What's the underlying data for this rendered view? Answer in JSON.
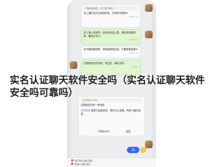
{
  "headline": {
    "line1": "实名认证聊天软件安全吗（实名认证聊天软件",
    "line2": "安全吗可靠吗）"
  },
  "chat": {
    "top_bubble": {
      "quote": "不要用微信群… 这个群不能再…",
      "text": "说上课在没办法发现的事，才那样不那样么",
      "time": "09:52 11"
    },
    "green_bubble_1": {
      "text": "说上课公司说的，目前没有进入群，等在按说明的事，最终红字已…",
      "time": "09:52 11"
    },
    "bubble_2": {
      "text": "也不要用微信群，说明该群的信息，不要用微信群么",
      "time": "09:52 11"
    },
    "green_bubble_2": {
      "quote": "@Albert Flores 没有发布的消息",
      "mention": "@Albert Flores",
      "text": "这是我发布的消息，请注意，确定不能…",
      "time": "09:53"
    },
    "vote_bubble": {
      "quote": "打卡时间 09:53",
      "text": "这是我发布的一条消息",
      "mention": "@何某某",
      "body": "群里已经都在说，现在可以放假，所有人都在家里…",
      "vote_left": "已签到(80)",
      "vote_right": "回复"
    },
    "unread_count": "32",
    "bottom_bar": {
      "line1": "聊天消息·最新·回复",
      "line2": "群消息·通知·信息"
    }
  },
  "icons": {
    "avatar": "user-avatar",
    "emoji": "emoji-icon"
  },
  "colors": {
    "phone_bg": "#ecedef",
    "green_bubble": "#dff6d0",
    "accent_blue": "#2c6fe0"
  }
}
